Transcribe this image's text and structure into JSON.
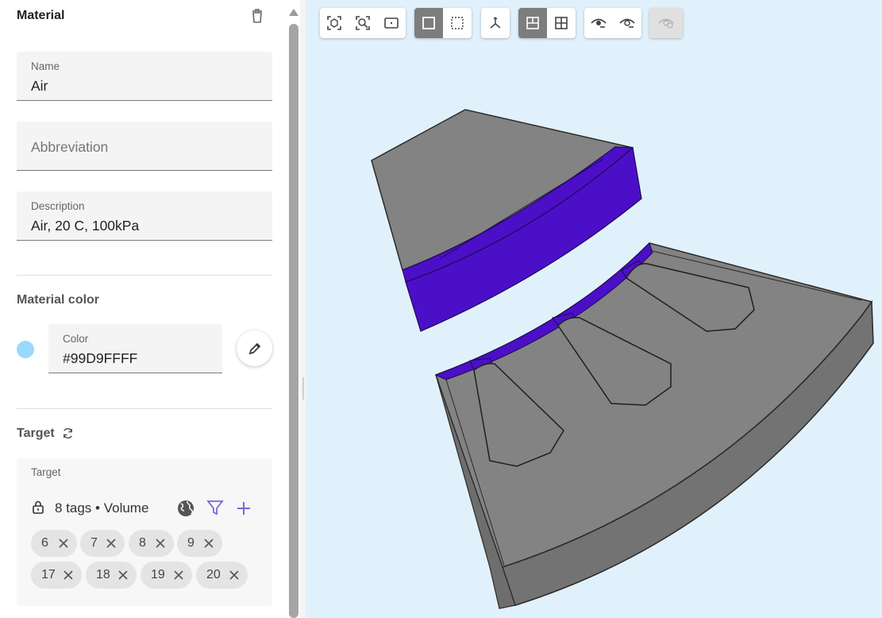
{
  "panel": {
    "title": "Material",
    "name_field": {
      "label": "Name",
      "value": "Air"
    },
    "abbreviation_field": {
      "placeholder": "Abbreviation",
      "value": ""
    },
    "description_field": {
      "label": "Description",
      "value": "Air, 20 C, 100kPa"
    },
    "color_section_title": "Material color",
    "color_field": {
      "label": "Color",
      "value": "#99D9FFFF"
    },
    "target_section_title": "Target",
    "target_box": {
      "label": "Target",
      "summary": "8 tags • Volume",
      "chips": [
        "6",
        "7",
        "8",
        "9",
        "17",
        "18",
        "19",
        "20"
      ]
    }
  },
  "viewport": {
    "toolbar_groups": [
      [
        "fit-all-icon",
        "zoom-selection-icon",
        "frame-icon"
      ],
      [
        "solid-view-icon",
        "wireframe-view-icon"
      ],
      [
        "axes-icon"
      ],
      [
        "single-view-icon",
        "quad-view-icon"
      ],
      [
        "show-icon",
        "hide-icon"
      ],
      [
        "hidden-toggle-icon"
      ]
    ]
  },
  "colors": {
    "material": "#99D9FF",
    "highlight": "#4b0fc7",
    "model": "#838383",
    "background": "#e1f1fc",
    "accent": "#7b68d9"
  }
}
